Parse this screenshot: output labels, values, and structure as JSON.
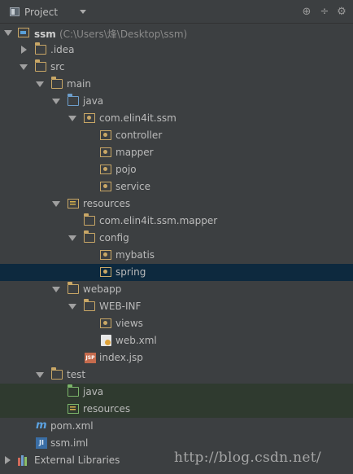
{
  "header": {
    "title": "Project",
    "tools": [
      "target-icon",
      "collapse-icon",
      "settings-icon"
    ]
  },
  "tree": [
    {
      "name": "ssm",
      "path": "(C:\\Users\\烽\\Desktop\\ssm)",
      "icon": "module-icon",
      "expanded": true,
      "bold": true
    },
    {
      "name": ".idea",
      "icon": "folder-icon",
      "expanded": false
    },
    {
      "name": "src",
      "icon": "folder-icon",
      "expanded": true
    },
    {
      "name": "main",
      "icon": "folder-icon",
      "expanded": true
    },
    {
      "name": "java",
      "icon": "source-folder-icon",
      "expanded": true
    },
    {
      "name": "com.elin4it.ssm",
      "icon": "package-icon",
      "expanded": true
    },
    {
      "name": "controller",
      "icon": "package-icon"
    },
    {
      "name": "mapper",
      "icon": "package-icon"
    },
    {
      "name": "pojo",
      "icon": "package-icon"
    },
    {
      "name": "service",
      "icon": "package-icon"
    },
    {
      "name": "resources",
      "icon": "resources-folder-icon",
      "expanded": true
    },
    {
      "name": "com.elin4it.ssm.mapper",
      "icon": "folder-icon"
    },
    {
      "name": "config",
      "icon": "folder-icon",
      "expanded": true
    },
    {
      "name": "mybatis",
      "icon": "package-icon"
    },
    {
      "name": "spring",
      "icon": "package-icon",
      "selected": true
    },
    {
      "name": "webapp",
      "icon": "folder-icon",
      "expanded": true
    },
    {
      "name": "WEB-INF",
      "icon": "folder-icon",
      "expanded": true
    },
    {
      "name": "views",
      "icon": "package-icon"
    },
    {
      "name": "web.xml",
      "icon": "xml-file-icon"
    },
    {
      "name": "index.jsp",
      "icon": "jsp-file-icon"
    },
    {
      "name": "test",
      "icon": "folder-icon",
      "expanded": true
    },
    {
      "name": "java",
      "icon": "test-folder-icon"
    },
    {
      "name": "resources",
      "icon": "test-resources-folder-icon"
    },
    {
      "name": "pom.xml",
      "icon": "maven-icon"
    },
    {
      "name": "ssm.iml",
      "icon": "iml-file-icon"
    },
    {
      "name": "External Libraries",
      "icon": "libraries-icon",
      "expanded": false
    }
  ],
  "watermark": "http://blog.csdn.net/",
  "colors": {
    "background": "#3c3f41",
    "selection": "#0d293e",
    "test_row": "#2f3a2f",
    "folder": "#c9a766",
    "source_folder": "#6d9ecb",
    "test_folder": "#7bb46a"
  }
}
